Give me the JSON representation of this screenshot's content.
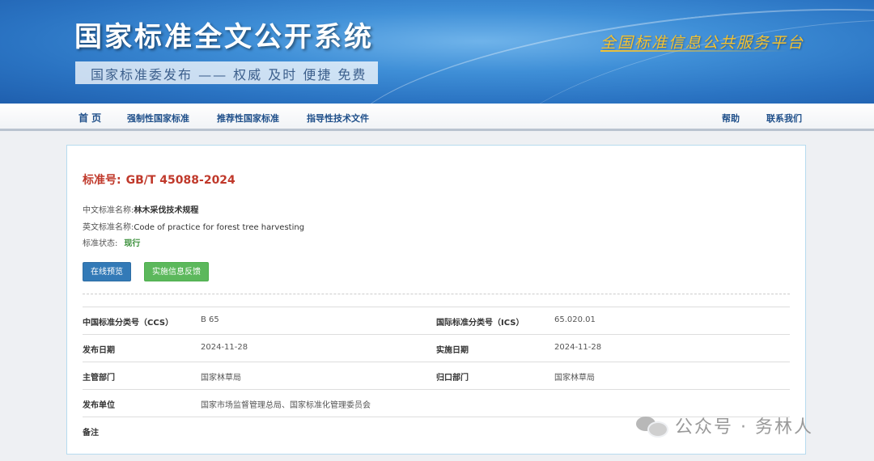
{
  "header": {
    "site_title": "国家标准全文公开系统",
    "slogan": "国家标准委发布 —— 权威 及时 便捷 免费",
    "right_slogan": "全国标准信息公共服务平台"
  },
  "nav": {
    "home": "首 页",
    "mandatory": "强制性国家标准",
    "recommended": "推荐性国家标准",
    "guiding": "指导性技术文件",
    "help": "帮助",
    "contact": "联系我们"
  },
  "standard": {
    "number_label": "标准号:",
    "number": "GB/T 45088-2024",
    "cn_name_label": "中文标准名称:",
    "cn_name": "林木采伐技术规程",
    "en_name_label": "英文标准名称:",
    "en_name": "Code of practice for forest tree harvesting",
    "status_label": "标准状态:",
    "status": "现行",
    "status_color": "#3a8f3a"
  },
  "buttons": {
    "preview": "在线预览",
    "feedback": "实施信息反馈"
  },
  "details": {
    "ccs_label": "中国标准分类号（CCS）",
    "ccs": "B 65",
    "ics_label": "国际标准分类号（ICS）",
    "ics": "65.020.01",
    "publish_date_label": "发布日期",
    "publish_date": "2024-11-28",
    "impl_date_label": "实施日期",
    "impl_date": "2024-11-28",
    "dept_label": "主管部门",
    "dept": "国家林草局",
    "belong_label": "归口部门",
    "belong": "国家林草局",
    "issuer_label": "发布单位",
    "issuer": "国家市场监督管理总局、国家标准化管理委员会",
    "remark_label": "备注",
    "remark": ""
  },
  "watermark": {
    "text": "公众号 · 务林人"
  }
}
